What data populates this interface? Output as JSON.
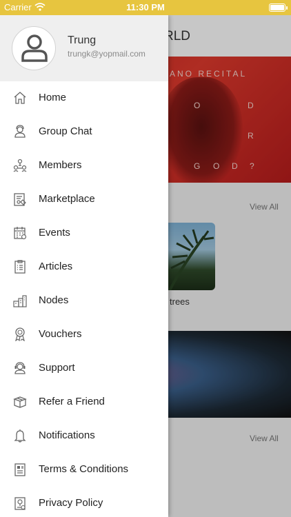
{
  "status_bar": {
    "carrier": "Carrier",
    "time": "11:30 PM"
  },
  "background": {
    "header_title_fragment": "RLD",
    "banner_title": "ANO RECITAL",
    "banner_letters": [
      "O",
      "D",
      "R",
      "G",
      "O",
      "D",
      "?"
    ],
    "view_all_1": "View All",
    "thumb_label": "trees",
    "view_all_2": "View All"
  },
  "profile": {
    "name": "Trung",
    "email": "trungk@yopmail.com",
    "avatar_icon": "user-icon"
  },
  "menu": {
    "items": [
      {
        "label": "Home",
        "icon": "home-icon"
      },
      {
        "label": "Group Chat",
        "icon": "group-chat-icon"
      },
      {
        "label": "Members",
        "icon": "members-icon"
      },
      {
        "label": "Marketplace",
        "icon": "marketplace-icon"
      },
      {
        "label": "Events",
        "icon": "calendar-icon"
      },
      {
        "label": "Articles",
        "icon": "articles-icon"
      },
      {
        "label": "Nodes",
        "icon": "nodes-icon"
      },
      {
        "label": "Vouchers",
        "icon": "voucher-icon"
      },
      {
        "label": "Support",
        "icon": "support-icon"
      },
      {
        "label": "Refer a Friend",
        "icon": "gift-box-icon"
      },
      {
        "label": "Notifications",
        "icon": "bell-icon"
      },
      {
        "label": "Terms & Conditions",
        "icon": "terms-icon"
      },
      {
        "label": "Privacy Policy",
        "icon": "privacy-icon"
      }
    ]
  },
  "colors": {
    "status_bar": "#e7c53f",
    "profile_bg": "#efefef",
    "icon_stroke": "#666666",
    "banner": "#c8201f"
  }
}
